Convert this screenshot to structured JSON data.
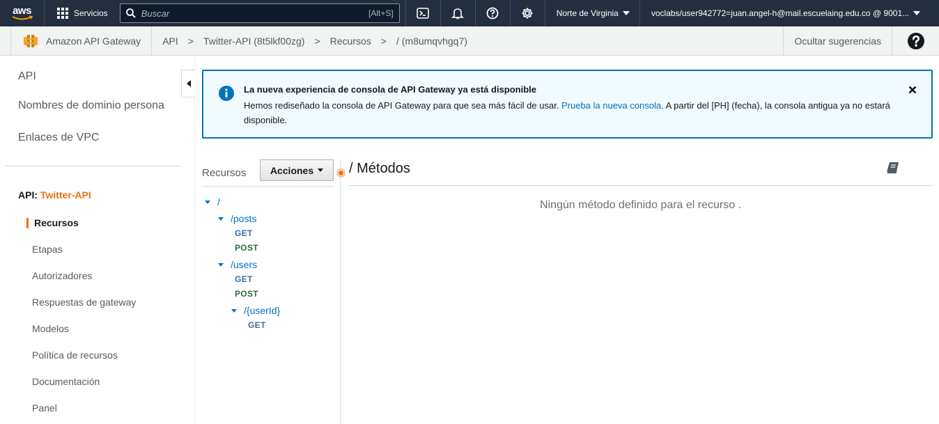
{
  "topnav": {
    "logo_text": "aws",
    "services_label": "Servicios",
    "search_placeholder": "Buscar",
    "search_shortcut": "[Alt+S]",
    "icons": [
      "cloudshell-icon",
      "bell-icon",
      "help-circle-icon",
      "gear-icon"
    ],
    "region": "Norte de Virginia",
    "account": "voclabs/user942772=juan.angel-h@mail.escuelaing.edu.co @ 9001..."
  },
  "service_header": {
    "service_name": "Amazon API Gateway",
    "breadcrumbs": [
      "API",
      "Twitter-API (8t5lkf00zg)",
      "Recursos",
      "/ (m8umqvhgq7)"
    ],
    "separator": ">",
    "hide_tips": "Ocultar sugerencias"
  },
  "sidebar": {
    "top_items": [
      "API",
      "Nombres de dominio persona",
      "Enlaces de VPC"
    ],
    "api_prefix": "API:",
    "api_name": "Twitter-API",
    "items": [
      {
        "label": "Recursos",
        "active": true
      },
      {
        "label": "Etapas"
      },
      {
        "label": "Autorizadores"
      },
      {
        "label": "Respuestas de gateway"
      },
      {
        "label": "Modelos"
      },
      {
        "label": "Política de recursos"
      },
      {
        "label": "Documentación"
      },
      {
        "label": "Panel"
      }
    ]
  },
  "flash": {
    "title": "La nueva experiencia de consola de API Gateway ya está disponible",
    "body_before": "Hemos rediseñado la consola de API Gateway para que sea más fácil de usar. ",
    "link": "Prueba la nueva consola",
    "body_after": ". A partir del [PH] (fecha), la consola antigua ya no estará disponible."
  },
  "resources": {
    "label": "Recursos",
    "actions_button": "Acciones",
    "tree": {
      "root": "/",
      "posts": "/posts",
      "posts_get": "GET",
      "posts_post": "POST",
      "users": "/users",
      "users_get": "GET",
      "users_post": "POST",
      "userid": "/{userId}",
      "userid_get": "GET"
    }
  },
  "methods": {
    "title": "/ Métodos",
    "empty_message": "Ningún método definido para el recurso ."
  },
  "colors": {
    "nav_bg": "#232f3e",
    "accent_orange": "#ec7211",
    "link_blue": "#0073bb",
    "info_bg": "#f1faff"
  }
}
